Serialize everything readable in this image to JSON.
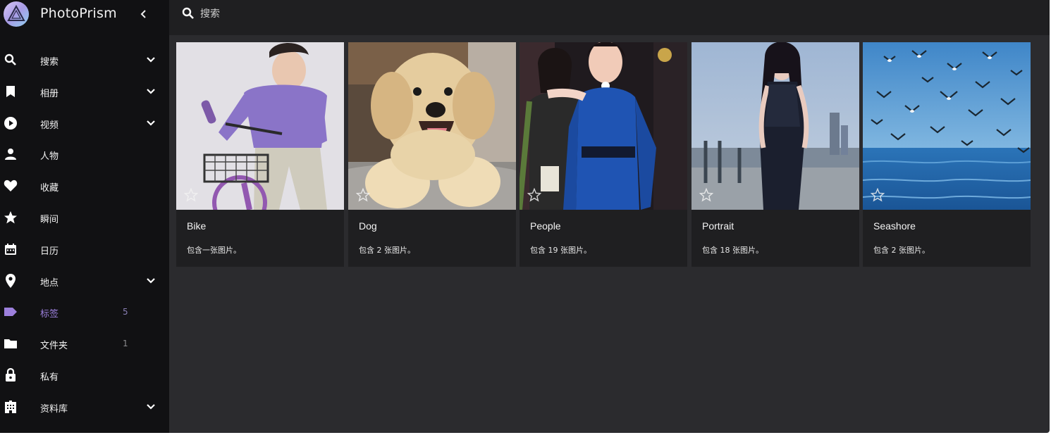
{
  "app": {
    "title": "PhotoPrism"
  },
  "search": {
    "placeholder": "搜索",
    "value": ""
  },
  "sidebar": {
    "items": [
      {
        "label": "搜索",
        "icon": "search-icon",
        "chevron": true
      },
      {
        "label": "相册",
        "icon": "bookmark-icon",
        "chevron": true
      },
      {
        "label": "视频",
        "icon": "play-circle-icon",
        "chevron": true
      },
      {
        "label": "人物",
        "icon": "person-icon",
        "chevron": false
      },
      {
        "label": "收藏",
        "icon": "heart-icon",
        "chevron": false
      },
      {
        "label": "瞬间",
        "icon": "star-icon",
        "chevron": false
      },
      {
        "label": "日历",
        "icon": "calendar-icon",
        "chevron": false
      },
      {
        "label": "地点",
        "icon": "map-pin-icon",
        "chevron": true
      },
      {
        "label": "标签",
        "icon": "label-icon",
        "count": "5",
        "active": true
      },
      {
        "label": "文件夹",
        "icon": "folder-icon",
        "count": "1"
      },
      {
        "label": "私有",
        "icon": "lock-icon",
        "chevron": false
      },
      {
        "label": "资料库",
        "icon": "library-icon",
        "chevron": true
      }
    ]
  },
  "labels": [
    {
      "title": "Bike",
      "caption": "包含一张图片。"
    },
    {
      "title": "Dog",
      "caption": "包含 2 张图片。"
    },
    {
      "title": "People",
      "caption": "包含 19 张图片。"
    },
    {
      "title": "Portrait",
      "caption": "包含 18 张图片。"
    },
    {
      "title": "Seashore",
      "caption": "包含 2 张图片。"
    }
  ],
  "colors": {
    "accent": "#9d80dd",
    "sidebar_bg": "#111113",
    "content_bg": "#2b2b2e",
    "card_bg": "#1f1f21"
  }
}
